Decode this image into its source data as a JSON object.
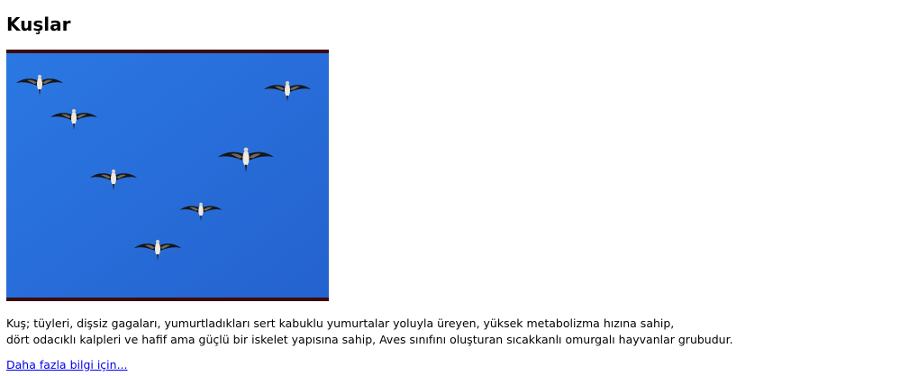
{
  "article": {
    "title": "Kuşlar",
    "image": {
      "subject": "flying-birds-photo",
      "sky_color": "#2a76e0",
      "frame_color": "#3b0a0a"
    },
    "description_lines": [
      "Kuş; tüyleri, dişsiz gagaları, yumurtladıkları sert kabuklu yumurtalar yoluyla üreyen, yüksek metabolizma hızına sahip,",
      "dört odacıklı kalpleri ve hafif ama güçlü bir iskelet yapısına sahip, Aves sınıfını oluşturan sıcakkanlı omurgalı hayvanlar grubudur."
    ],
    "more_link_label": "Daha fazla bilgi için..."
  }
}
